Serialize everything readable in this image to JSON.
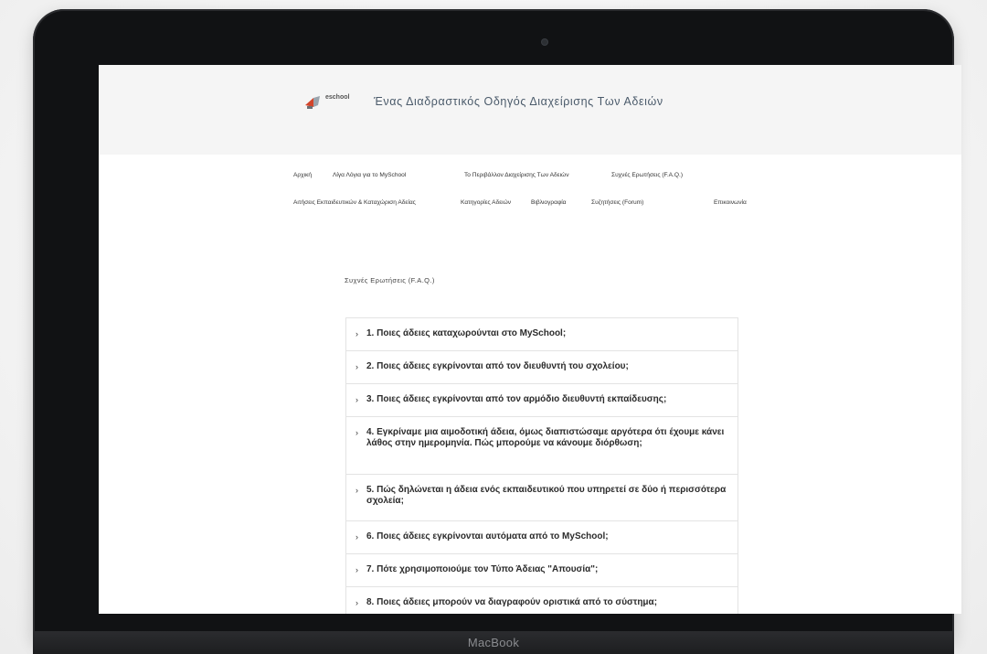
{
  "device": {
    "brand": "MacBook"
  },
  "site": {
    "logo_text": "eschool",
    "title": "Ένας Διαδραστικός Οδηγός Διαχείρισης Των Αδειών"
  },
  "nav": {
    "row1": [
      "Αρχική",
      "Λίγα Λόγια για το MySchool",
      "Το Περιβάλλον Διαχείρισης Των Αδειών",
      "Συχνές Ερωτήσεις (F.A.Q.)"
    ],
    "row2": [
      "Αιτήσεις Εκπαιδευτικών & Καταχώριση Αδείας",
      "Κατηγορίες Αδειών",
      "Βιβλιογραφία",
      "Συζητήσεις (Forum)",
      "Επικοινωνία"
    ]
  },
  "page": {
    "breadcrumb": "Συχνές Ερωτήσεις (F.A.Q.)"
  },
  "faq": [
    "1. Ποιες άδειες καταχωρούνται στο MySchool;",
    "2. Ποιες άδειες εγκρίνονται από τον διευθυντή του σχολείου;",
    "3. Ποιες άδειες εγκρίνονται από τον αρμόδιο διευθυντή εκπαίδευσης;",
    "4. Εγκρίναμε μια αιμοδοτική άδεια, όμως διαπιστώσαμε αργότερα ότι έχουμε κάνει λάθος στην ημερομηνία. Πώς μπορούμε να κάνουμε διόρθωση;",
    "5. Πώς δηλώνεται η άδεια ενός εκπαιδευτικού που υπηρετεί σε δύο ή περισσότερα σχολεία;",
    "6. Ποιες άδειες εγκρίνονται αυτόματα από το MySchool;",
    "7. Πότε χρησιμοποιούμε τον Τύπο Άδειας \"Απουσία\";",
    "8. Ποιες άδειες μπορούν να διαγραφούν οριστικά από το σύστημα;"
  ]
}
